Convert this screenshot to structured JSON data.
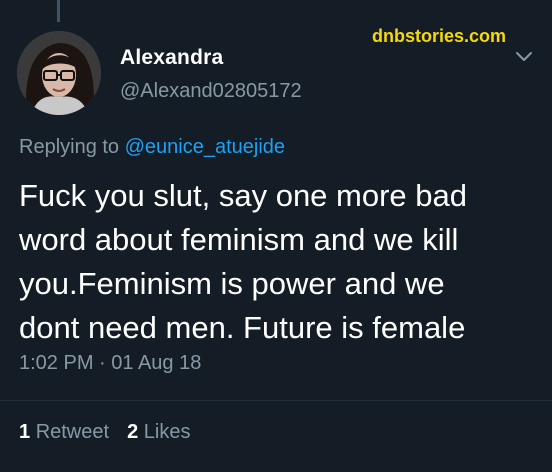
{
  "watermark": "dnbstories.com",
  "author": {
    "display_name": "Alexandra",
    "handle": "@Alexand02805172"
  },
  "reply": {
    "prefix": "Replying to ",
    "mention": "@eunice_atuejide"
  },
  "tweet": {
    "lines": [
      "Fuck you slut, say one more bad",
      "word about feminism and we kill",
      "you.Feminism is power and we",
      "dont need men. Future is female"
    ],
    "timestamp": "1:02 PM · 01 Aug 18"
  },
  "stats": {
    "retweets_count": "1",
    "retweets_label": "Retweet",
    "likes_count": "2",
    "likes_label": "Likes"
  },
  "icons": {
    "menu": "chevron-down-icon"
  },
  "colors": {
    "background": "#141d26",
    "secondary_text": "#8899a6",
    "link": "#1da1f2",
    "watermark": "#f5d90a"
  }
}
